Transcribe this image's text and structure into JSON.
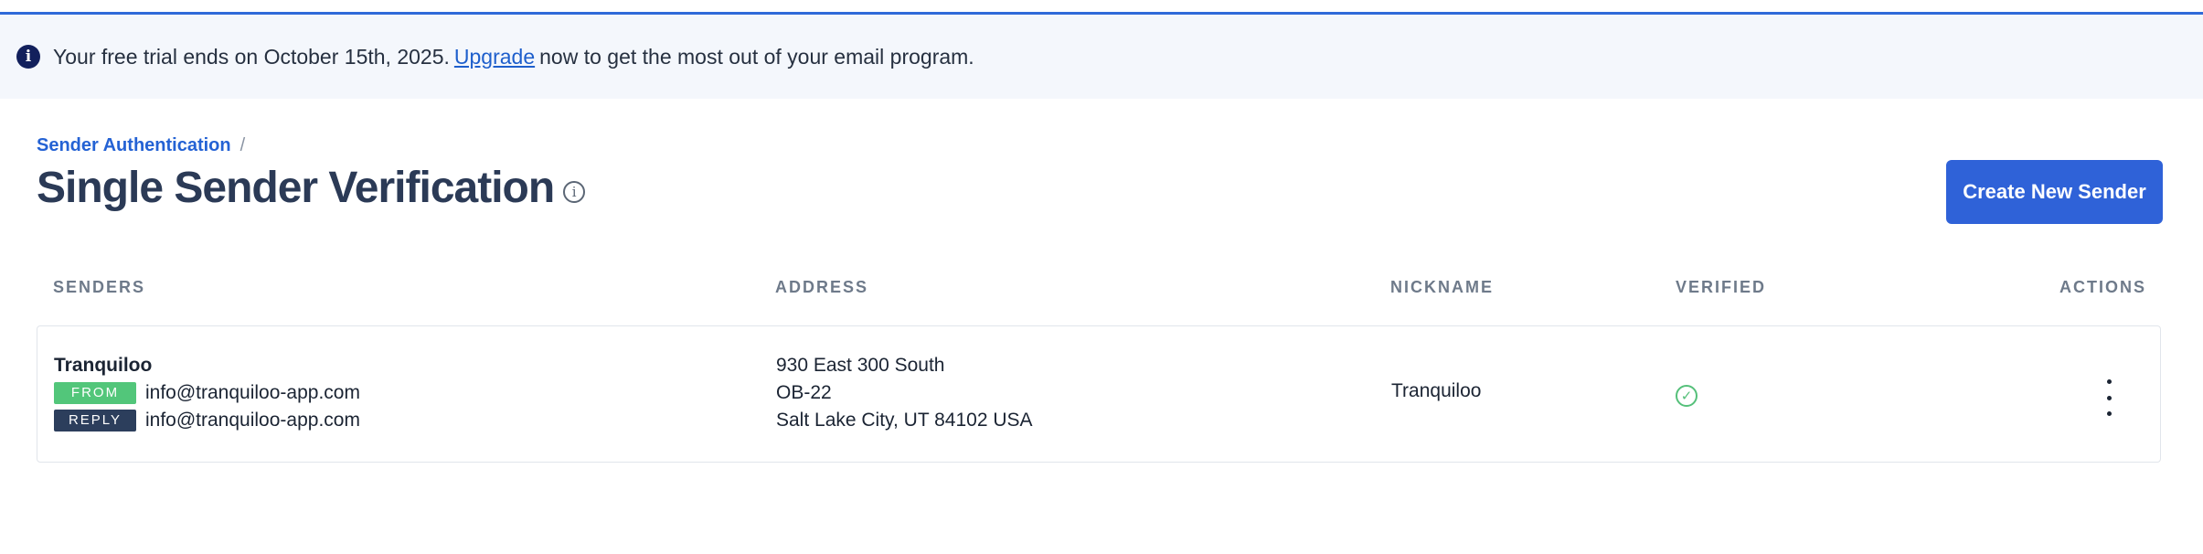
{
  "banner": {
    "icon": "info-icon",
    "text_before": "Your free trial ends on October 15th, 2025.",
    "link_label": "Upgrade",
    "text_after": "now to get the most out of your email program."
  },
  "breadcrumb": {
    "link_label": "Sender Authentication",
    "separator": "/"
  },
  "page": {
    "title": "Single Sender Verification",
    "info_icon": "info-outline-icon"
  },
  "actions": {
    "create_label": "Create New Sender"
  },
  "table": {
    "headers": {
      "senders": "SENDERS",
      "address": "ADDRESS",
      "nickname": "NICKNAME",
      "verified": "VERIFIED",
      "actions": "ACTIONS"
    },
    "rows": [
      {
        "sender_name": "Tranquiloo",
        "from_badge": "FROM",
        "from_email": "info@tranquiloo-app.com",
        "reply_badge": "REPLY",
        "reply_email": "info@tranquiloo-app.com",
        "address_line1": "930 East 300 South",
        "address_line2": "OB-22",
        "address_line3": "Salt Lake City, UT 84102 USA",
        "nickname": "Tranquiloo",
        "verified": true,
        "verified_icon": "check-circle-icon",
        "actions_icon": "kebab-menu-icon"
      }
    ]
  },
  "colors": {
    "accent": "#2f62d8",
    "banner_bg": "#f4f7fc",
    "title": "#2b3a56",
    "from_badge": "#52c67a",
    "reply_badge": "#2c3e5c",
    "verified": "#55c07a"
  }
}
